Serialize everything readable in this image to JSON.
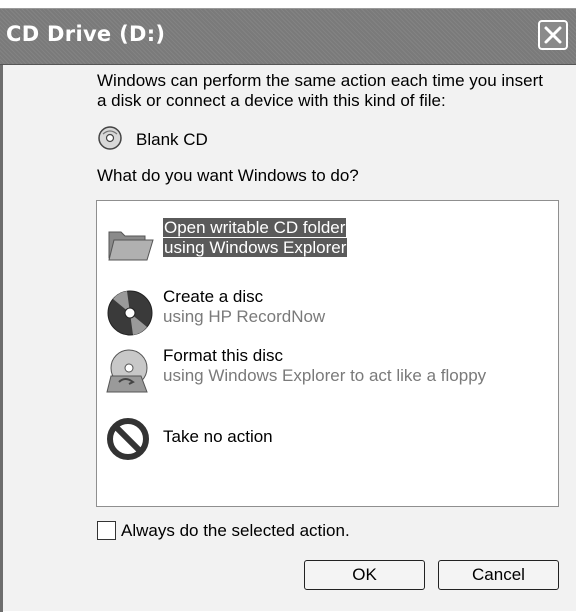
{
  "window": {
    "title": "CD Drive (D:)"
  },
  "dialog": {
    "intro_line1": "Windows can perform the same action each time you insert",
    "intro_line2": "a disk or connect a device with this kind of file:",
    "content_type": "Blank CD",
    "question": "What do you want Windows to do?",
    "actions": [
      {
        "line1": "Open writable CD folder",
        "line2": "using Windows Explorer",
        "icon": "folder-icon",
        "selected": true
      },
      {
        "line1": "Create a disc",
        "line2": "using HP RecordNow",
        "icon": "disc-burn-icon",
        "selected": false
      },
      {
        "line1": "Format this disc",
        "line2": "using Windows Explorer to act like a floppy",
        "icon": "format-disc-icon",
        "selected": false
      },
      {
        "line1": "Take no action",
        "line2": "",
        "icon": "no-action-icon",
        "selected": false
      }
    ],
    "always_label": "Always do the selected action.",
    "always_checked": false,
    "ok_label": "OK",
    "cancel_label": "Cancel"
  },
  "colors": {
    "titlebar": "#7a7a7a",
    "selection": "#5a5a5a",
    "secondary_text": "#7a7a7a"
  }
}
